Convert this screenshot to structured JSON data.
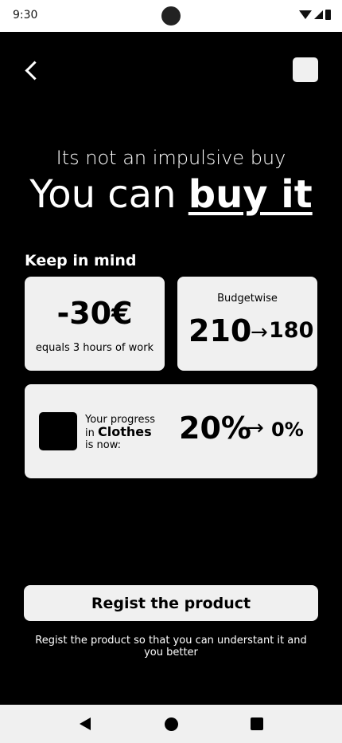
{
  "status_bar": {
    "time": "9:30",
    "icons": [
      "wifi-icon",
      "signal-icon",
      "battery-icon"
    ]
  },
  "header": {
    "back_icon": "chevron-left-icon",
    "menu_icon": "square-button"
  },
  "hero": {
    "subtitle": "Its not an impulsive buy",
    "headline_prefix": "You can",
    "headline_emphasis": "buy it"
  },
  "section": {
    "label": "Keep in mind"
  },
  "cost_card": {
    "value": "-30€",
    "note": "equals 3 hours of work"
  },
  "budget_card": {
    "title": "Budgetwise",
    "from": "210",
    "arrow": "→",
    "to": "180"
  },
  "progress_card": {
    "line1": "Your progress",
    "line2_prefix": "in",
    "category": "Clothes",
    "line3": "is now:",
    "from": "20%",
    "arrow": "→",
    "to": "0%"
  },
  "actions": {
    "primary_label": "Regist the product",
    "hint": "Regist the product so that you can understant it and you better"
  },
  "colors": {
    "background": "#000000",
    "card": "#f0f0f0",
    "text_on_dark": "#ffffff",
    "text_on_card": "#000000"
  }
}
